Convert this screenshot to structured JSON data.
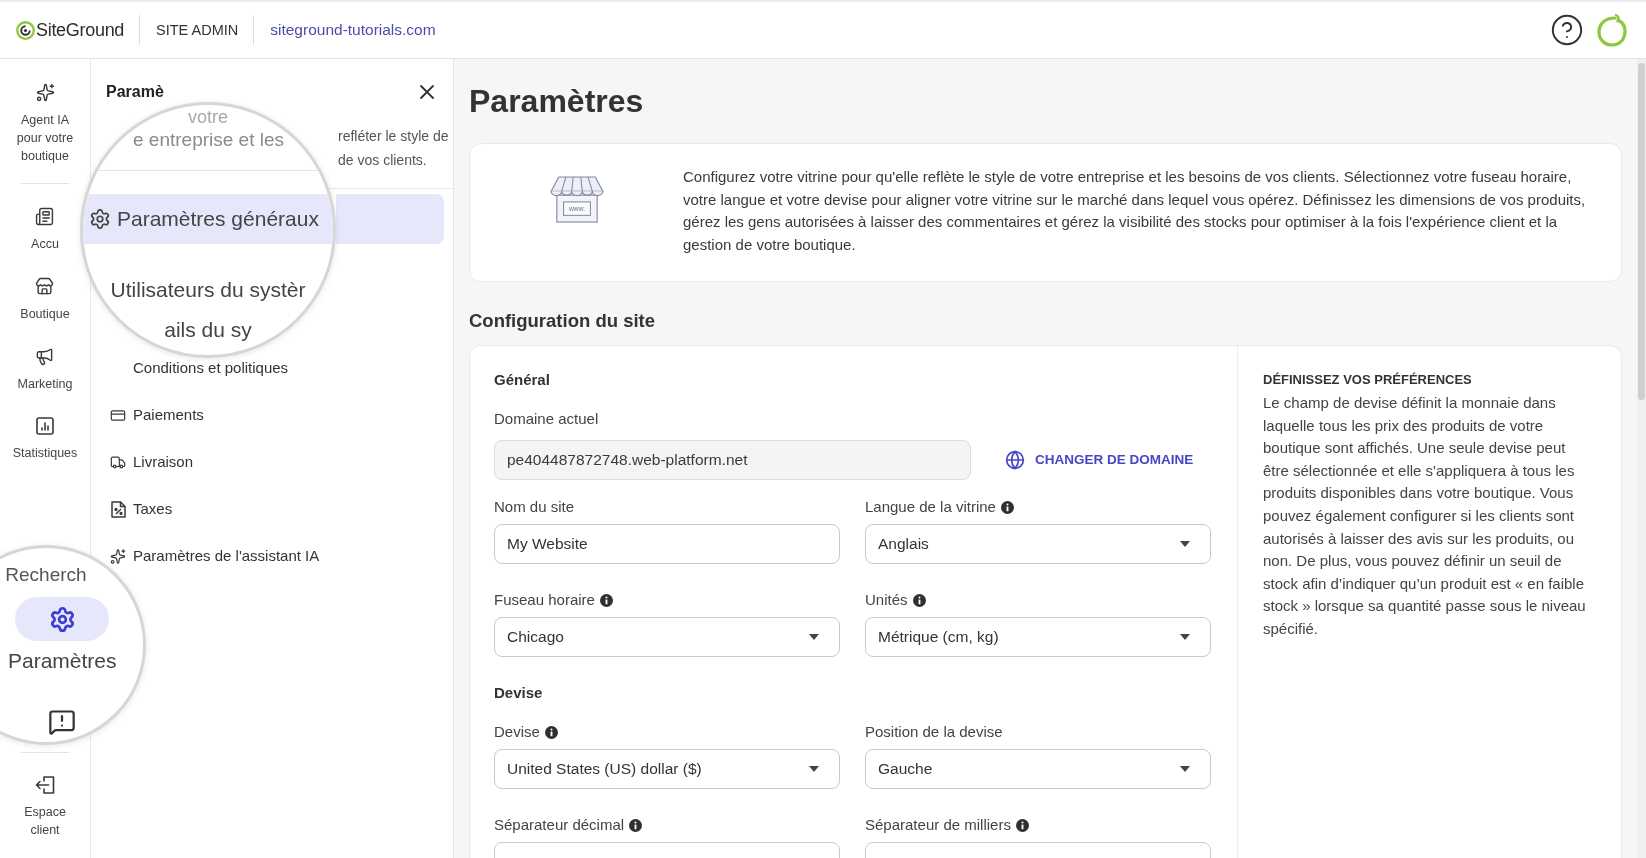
{
  "top_bar": {
    "logo": "SiteGround",
    "section": "SITE ADMIN",
    "site_link": "siteground-tutorials.com"
  },
  "rail": {
    "items": [
      {
        "label": "Agent IA pour votre boutique",
        "selected": false
      },
      {
        "label": "Accu",
        "selected": false
      },
      {
        "label": "Boutique",
        "selected": false
      },
      {
        "label": "Marketing",
        "selected": false
      },
      {
        "label": "Statistiques",
        "selected": false
      }
    ],
    "footer_item": {
      "label": "Espace client",
      "selected": false
    }
  },
  "rail_magnifier": {
    "search_label": "Recherch",
    "item": {
      "label": "Paramètres",
      "selected": true
    }
  },
  "settings_panel": {
    "title": "Paramè",
    "description_lines": [
      "refléter le style de",
      "de vos clients."
    ],
    "items": [
      {
        "label": "Conditions et politiques",
        "selected": false
      },
      {
        "label": "Paiements",
        "selected": false
      },
      {
        "label": "Livraison",
        "selected": false
      },
      {
        "label": "Taxes",
        "selected": false
      },
      {
        "label": "Paramètres de l'assistant IA",
        "selected": false
      }
    ]
  },
  "panel_magnifier": {
    "text_lines": [
      "votre",
      "e entreprise et les"
    ],
    "items": [
      {
        "label": "Paramètres généraux",
        "selected": true
      },
      {
        "label": "Utilisateurs du systèr",
        "selected": false
      },
      {
        "label": "ails du sy",
        "selected": false
      }
    ]
  },
  "page": {
    "title": "Paramètres",
    "intro": {
      "illustration_text": "www.",
      "text": "Configurez votre vitrine pour qu'elle reflète le style de votre entreprise et les besoins de vos clients. Sélectionnez votre fuseau horaire, votre langue et votre devise pour aligner votre vitrine sur le marché dans lequel vous opérez. Définissez les dimensions de vos produits, gérez les gens autorisées à laisser des commentaires et gérez la visibilité des stocks pour optimiser à la fois l'expérience client et la gestion de votre boutique."
    }
  },
  "site_configuration": {
    "title": "Configuration du site",
    "sections": [
      {
        "heading": "Général",
        "domain": {
          "label": "Domaine actuel",
          "value": "pe404487872748.web-platform.net",
          "disabled": true,
          "action": "CHANGER DE DOMAINE"
        },
        "fields": [
          {
            "label": "Nom du site",
            "kind": "text",
            "value": "My Website",
            "info": false
          },
          {
            "label": "Langue de la vitrine",
            "kind": "select",
            "value": "Anglais",
            "info": true
          },
          {
            "label": "Fuseau horaire",
            "kind": "select",
            "value": "Chicago",
            "info": true
          },
          {
            "label": "Unités",
            "kind": "select",
            "value": "Métrique (cm, kg)",
            "info": true
          }
        ]
      },
      {
        "heading": "Devise",
        "fields": [
          {
            "label": "Devise",
            "kind": "select",
            "value": "United States (US) dollar ($)",
            "info": true
          },
          {
            "label": "Position de la devise",
            "kind": "select",
            "value": "Gauche",
            "info": false
          },
          {
            "label": "Séparateur décimal",
            "kind": "text",
            "info": true
          },
          {
            "label": "Séparateur de milliers",
            "kind": "text",
            "info": true
          }
        ]
      }
    ],
    "help": {
      "heading": "DÉFINISSEZ VOS PRÉFÉRENCES",
      "text": "Le champ de devise définit la monnaie dans laquelle tous les prix des produits de votre boutique sont affichés. Une seule devise peut être sélectionnée et elle s'appliquera à tous les produits disponibles dans votre boutique. Vous pouvez également configurer si les clients sont autorisés à laisser des avis sur les produits, ou non. De plus, vous pouvez définir un seuil de stock afin d’indiquer qu’un produit est « en faible stock » lorsque sa quantité passe sous le niveau spécifié."
    }
  }
}
